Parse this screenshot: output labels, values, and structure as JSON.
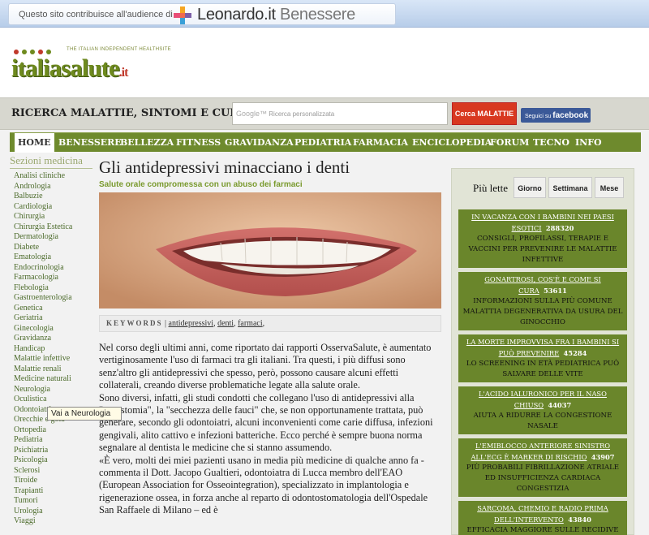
{
  "topbar": {
    "message": "Questo sito contribuisce all'audience di",
    "brand": "Leonardo.it",
    "brand_suffix": "Benessere"
  },
  "logo": {
    "tagline": "THE ITALIAN INDEPENDENT HEALTHSITE",
    "name": "italiasalute",
    "tld": ".it"
  },
  "search": {
    "label": "RICERCA MALATTIE, SINTOMI E CURE:",
    "google": "Google™",
    "placeholder": "Ricerca personalizzata",
    "button": "Cerca MALATTIE",
    "fb_prefix": "Seguici su",
    "fb_name": "facebook"
  },
  "nav": [
    "HOME",
    "BENESSERE",
    "BELLEZZA",
    "FITNESS",
    "GRAVIDANZA",
    "PEDIATRIA",
    "FARMACIA",
    "ENCICLOPEDIA",
    "FORUM",
    "TECNO",
    "INFO"
  ],
  "sidebar": {
    "title": "Sezioni medicina",
    "items": [
      "Analisi cliniche",
      "Andrologia",
      "Balbuzie",
      "Cardiologia",
      "Chirurgia",
      "Chirurgia Estetica",
      "Dermatologia",
      "Diabete",
      "Ematologia",
      "Endocrinologia",
      "Farmacologia",
      "Flebologia",
      "Gastroenterologia",
      "Genetica",
      "Geriatria",
      "Ginecologia",
      "Gravidanza",
      "Handicap",
      "Malattie infettive",
      "Malattie renali",
      "Medicine naturali",
      "Neurologia",
      "Oculistica",
      "Odontoiatria",
      "Orecchie e gola",
      "Ortopedia",
      "Pediatria",
      "Psichiatria",
      "Psicologia",
      "Sclerosi",
      "Tiroide",
      "Trapianti",
      "Tumori",
      "Urologia",
      "Viaggi"
    ],
    "tooltip": "Vai a Neurologia"
  },
  "article": {
    "title": "Gli antidepressivi minacciano i denti",
    "subtitle": "Salute orale compromessa con un abuso dei farmaci",
    "keywords_label": "KEYWORDS",
    "keywords": [
      "antidepressivi",
      "denti",
      "farmaci"
    ],
    "paragraphs": [
      "Nel corso degli ultimi anni, come riportato dai rapporti OsservaSalute, è aumentato vertiginosamente l'uso di farmaci tra gli italiani. Tra questi, i più diffusi sono senz'altro gli antidepressivi che spesso, però, possono causare alcuni effetti collaterali, creando diverse problematiche legate alla salute orale.",
      "Sono diversi, infatti, gli studi condotti che collegano l'uso di antidepressivi alla \"xerostomia\", la \"secchezza delle fauci\" che, se non opportunamente trattata, può generare, secondo gli odontoiatri, alcuni inconvenienti come carie diffusa, infezioni gengivali, alito cattivo e infezioni batteriche. Ecco perché è sempre buona norma segnalare al dentista le medicine che si stanno assumendo.",
      "«È vero, molti dei miei pazienti usano in media più medicine di qualche anno fa - commenta il Dott. Jacopo Gualtieri, odontoiatra di Lucca membro dell'EAO (European Association for Osseointegration), specializzato in implantologia e rigenerazione ossea, in forza anche al reparto di odontostomatologia dell'Ospedale San Raffaele di Milano – ed è"
    ]
  },
  "popular": {
    "label": "Più lette",
    "tabs": [
      "Giorno",
      "Settimana",
      "Mese"
    ],
    "entries": [
      {
        "title": "IN VACANZA CON I BAMBINI NEI PAESI ESOTICI",
        "count": "288320",
        "desc": "CONSIGLI, PROFILASSI, TERAPIE E VACCINI PER PREVENIRE LE MALATTIE INFETTIVE"
      },
      {
        "title": "GONARTROSI, COS'È E COME SI CURA",
        "count": "53611",
        "desc": "INFORMAZIONI SULLA PIÙ COMUNE MALATTIA DEGENERATIVA DA USURA DEL GINOCCHIO"
      },
      {
        "title": "LA MORTE IMPROVVISA FRA I BAMBINI SI PUÒ PREVENIRE",
        "count": "45284",
        "desc": "LO SCREENING IN ETÀ PEDIATRICA PUÒ SALVARE DELLE VITE"
      },
      {
        "title": "L'ACIDO IALURONICO PER IL NASO CHIUSO",
        "count": "44037",
        "desc": "AIUTA A RIDURRE LA CONGESTIONE NASALE"
      },
      {
        "title": "L'EMIBLOCCO ANTERIORE SINISTRO ALL'ECG È MARKER DI RISCHIO",
        "count": "43907",
        "desc": "PIÙ PROBABILI FIBRILLAZIONE ATRIALE ED INSUFFICIENZA CARDIACA CONGESTIZIA"
      },
      {
        "title": "SARCOMA, CHEMIO E RADIO PRIMA DELL'INTERVENTO",
        "count": "43840",
        "desc": "EFFICACIA MAGGIORE SULLE RECIDIVE"
      }
    ]
  },
  "colors": {
    "nav_green": "#6e8a2d",
    "link_green": "#4c6b2b",
    "accent_red": "#d83820",
    "facebook_blue": "#3b5998"
  }
}
